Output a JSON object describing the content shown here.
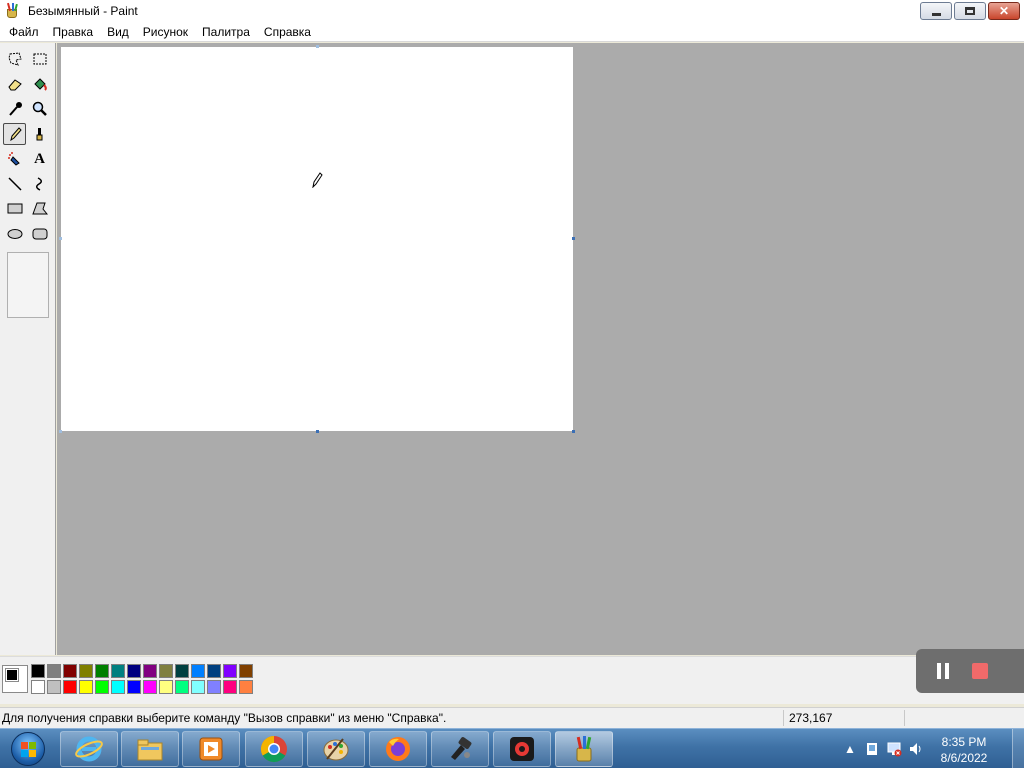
{
  "window": {
    "title": "Безымянный - Paint"
  },
  "menu": {
    "items": [
      "Файл",
      "Правка",
      "Вид",
      "Рисунок",
      "Палитра",
      "Справка"
    ]
  },
  "toolbox": {
    "tools": [
      {
        "name": "free-select-icon",
        "active": false
      },
      {
        "name": "rect-select-icon",
        "active": false
      },
      {
        "name": "eraser-icon",
        "active": false
      },
      {
        "name": "fill-bucket-icon",
        "active": false
      },
      {
        "name": "color-picker-icon",
        "active": false
      },
      {
        "name": "magnifier-icon",
        "active": false
      },
      {
        "name": "pencil-icon",
        "active": true
      },
      {
        "name": "brush-icon",
        "active": false
      },
      {
        "name": "airbrush-icon",
        "active": false
      },
      {
        "name": "text-icon",
        "active": false
      },
      {
        "name": "line-icon",
        "active": false
      },
      {
        "name": "curve-icon",
        "active": false
      },
      {
        "name": "rectangle-icon",
        "active": false
      },
      {
        "name": "polygon-icon",
        "active": false
      },
      {
        "name": "ellipse-icon",
        "active": false
      },
      {
        "name": "rounded-rectangle-icon",
        "active": false
      }
    ],
    "text_tool_glyph": "A"
  },
  "palette": {
    "foreground": "#000000",
    "background": "#ffffff",
    "top_row": [
      "#000000",
      "#808080",
      "#800000",
      "#808000",
      "#008000",
      "#008080",
      "#000080",
      "#800080",
      "#808040",
      "#004040",
      "#0080ff",
      "#004080",
      "#8000ff",
      "#804000"
    ],
    "bottom_row": [
      "#ffffff",
      "#c0c0c0",
      "#ff0000",
      "#ffff00",
      "#00ff00",
      "#00ffff",
      "#0000ff",
      "#ff00ff",
      "#ffff80",
      "#00ff80",
      "#80ffff",
      "#8080ff",
      "#ff0080",
      "#ff8040"
    ]
  },
  "status": {
    "help_text": "Для получения справки выберите команду \"Вызов справки\" из меню \"Справка\".",
    "coords": "273,167"
  },
  "recorder": {
    "pause_icon": "pause-icon",
    "stop_icon": "stop-icon",
    "stop_color": "#f06a6a"
  },
  "taskbar": {
    "apps": [
      {
        "name": "internet-explorer-icon",
        "active": false
      },
      {
        "name": "file-explorer-icon",
        "active": false
      },
      {
        "name": "media-player-icon",
        "active": false
      },
      {
        "name": "chrome-icon",
        "active": false
      },
      {
        "name": "paint-palette-icon",
        "active": false
      },
      {
        "name": "firefox-icon",
        "active": false
      },
      {
        "name": "fixer-tool-icon",
        "active": false
      },
      {
        "name": "screen-recorder-icon",
        "active": false
      },
      {
        "name": "paint-app-icon",
        "active": true
      }
    ],
    "clock_time": "8:35 PM",
    "clock_date": "8/6/2022"
  }
}
